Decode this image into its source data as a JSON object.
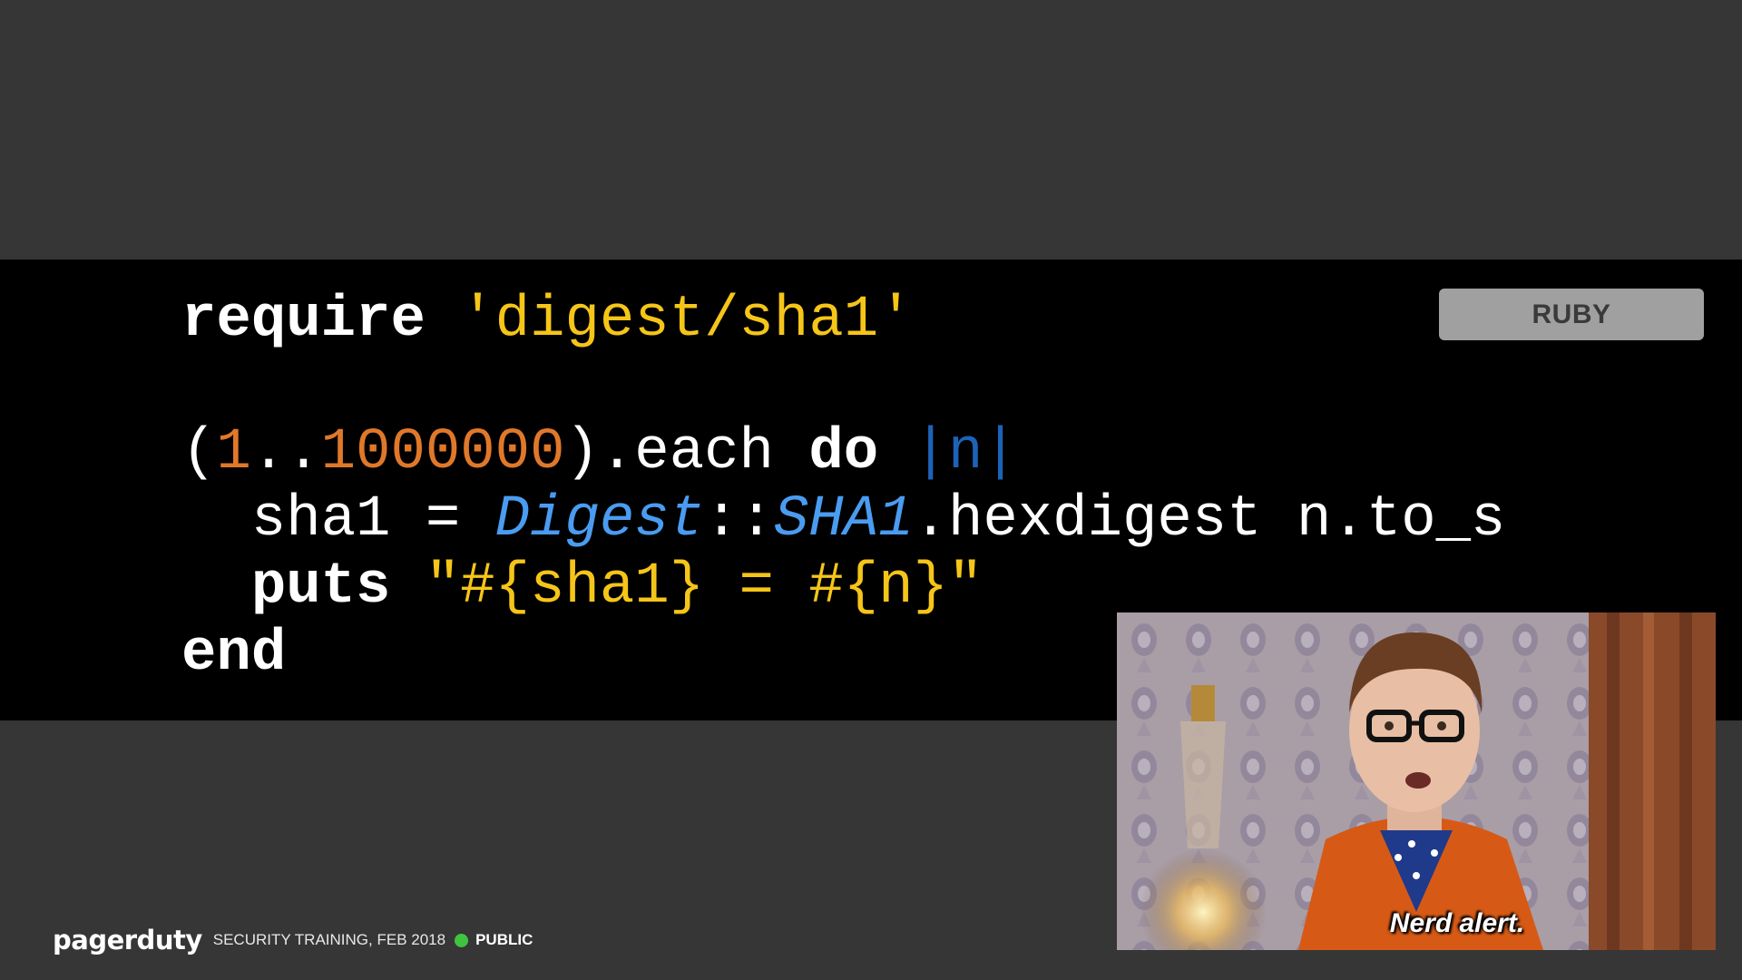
{
  "slide": {
    "language_badge": "RUBY",
    "code": {
      "line1": {
        "keyword": "require",
        "space": " ",
        "string": "'digest/sha1'"
      },
      "line2": {
        "open": "(",
        "start": "1",
        "range": "..",
        "end": "1000000",
        "close": ").each ",
        "keyword": "do",
        "space": " ",
        "param": "|n|"
      },
      "line3": {
        "indent": "  ",
        "lhs": "sha1 = ",
        "const1": "Digest",
        "sep": "::",
        "const2": "SHA1",
        "rest": ".hexdigest n.to_s"
      },
      "line4": {
        "indent": "  ",
        "keyword": "puts",
        "space": " ",
        "string": "\"#{sha1} = #{n}\""
      },
      "line5": {
        "keyword": "end"
      }
    },
    "meme_caption": "Nerd alert."
  },
  "footer": {
    "logo": "pagerduty",
    "text": "SECURITY TRAINING, FEB 2018",
    "status": "PUBLIC",
    "status_color": "#3fc43f"
  }
}
